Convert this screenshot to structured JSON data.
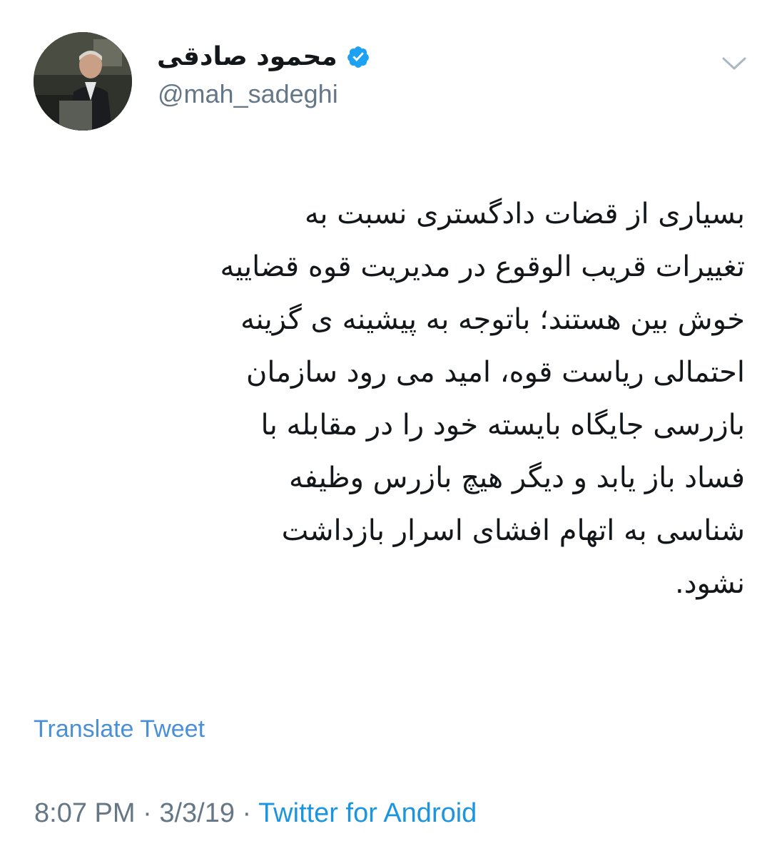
{
  "author": {
    "display_name": "محمود صادقی",
    "handle": "@mah_sadeghi",
    "verified": true
  },
  "tweet": {
    "lines": [
      "بسیاری از قضات دادگستری نسبت به",
      "تغییرات قریب الوقوع در مدیریت قوه قضاییه",
      "خوش بین هستند؛ باتوجه به پیشینه ی گزینه",
      "احتمالی ریاست قوه، امید می رود سازمان",
      "بازرسی جایگاه بایسته خود را در مقابله با",
      "فساد باز یابد و دیگر هیچ بازرس وظیفه",
      "شناسی به اتهام افشای اسرار بازداشت",
      "نشود."
    ]
  },
  "actions": {
    "translate_label": "Translate Tweet"
  },
  "meta": {
    "time": "8:07 PM",
    "separator1": " · ",
    "date": "3/3/19",
    "separator2": " · ",
    "source": "Twitter for Android"
  },
  "icons": {
    "verified": "verified-badge-icon",
    "menu": "chevron-down-icon"
  },
  "colors": {
    "verified": "#1da1f2",
    "link": "#1b95e0",
    "secondary_text": "#657786",
    "primary_text": "#14171a"
  }
}
